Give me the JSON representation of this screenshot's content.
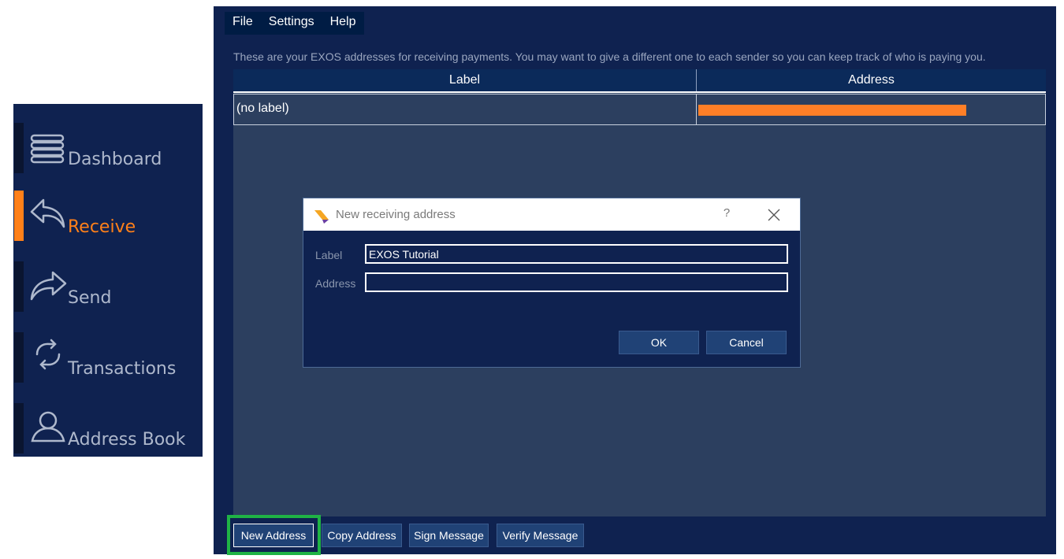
{
  "sidebar": {
    "items": [
      {
        "label": "Dashboard",
        "icon": "dashboard-icon",
        "active": false
      },
      {
        "label": "Receive",
        "icon": "receive-arrow-icon",
        "active": true
      },
      {
        "label": "Send",
        "icon": "send-arrow-icon",
        "active": false
      },
      {
        "label": "Transactions",
        "icon": "transactions-cycle-icon",
        "active": false
      },
      {
        "label": "Address Book",
        "icon": "address-book-person-icon",
        "active": false
      }
    ]
  },
  "menu": {
    "file": "File",
    "settings": "Settings",
    "help": "Help"
  },
  "info_text": "These are your EXOS addresses for receiving payments. You may want to give a different one to each sender so you can keep track of who is paying you.",
  "table": {
    "columns": [
      "Label",
      "Address"
    ],
    "rows": [
      {
        "label": "(no label)",
        "address": ""
      }
    ]
  },
  "buttons": {
    "new_address": "New Address",
    "copy_address": "Copy Address",
    "sign_message": "Sign Message",
    "verify_message": "Verify Message"
  },
  "dialog": {
    "title": "New receiving address",
    "help": "?",
    "label_field": {
      "label": "Label",
      "value": "EXOS Tutorial"
    },
    "address_field": {
      "label": "Address",
      "value": ""
    },
    "ok": "OK",
    "cancel": "Cancel"
  },
  "colors": {
    "accent": "#ff8019",
    "background": "#0f2250",
    "highlight": "#1fb345",
    "redaction": "#ff7f27"
  }
}
